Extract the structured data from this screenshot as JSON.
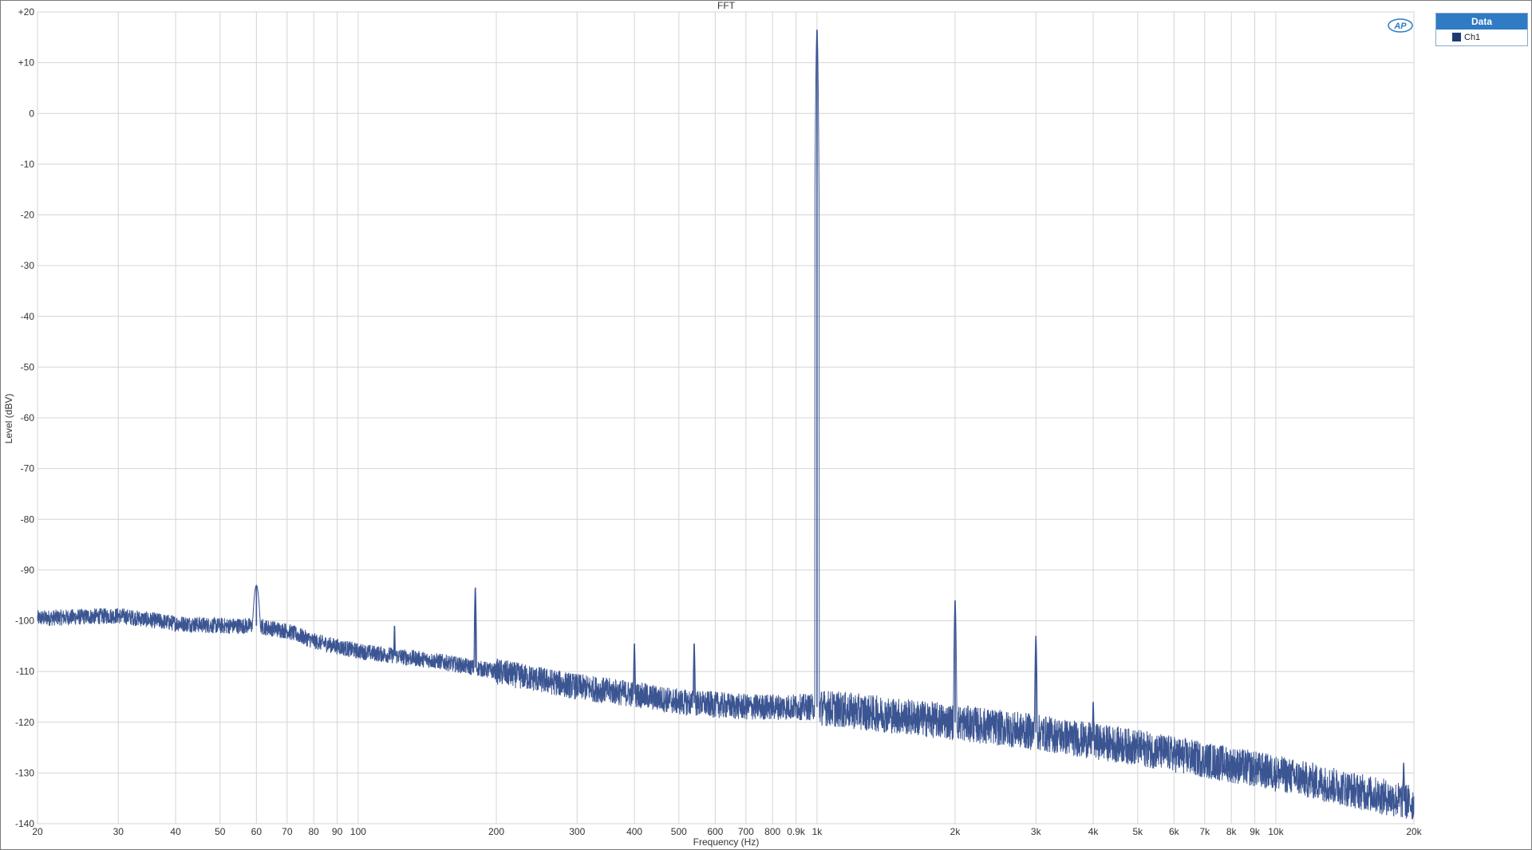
{
  "chart_data": {
    "type": "line",
    "title": "FFT",
    "xlabel": "Frequency (Hz)",
    "ylabel": "Level (dBV)",
    "x_scale": "log",
    "xlim": [
      20,
      20000
    ],
    "ylim": [
      -140,
      20
    ],
    "grid": true,
    "legend_position": "top-right",
    "x_ticks": [
      {
        "v": 20,
        "label": "20"
      },
      {
        "v": 30,
        "label": "30"
      },
      {
        "v": 40,
        "label": "40"
      },
      {
        "v": 50,
        "label": "50"
      },
      {
        "v": 60,
        "label": "60"
      },
      {
        "v": 70,
        "label": "70"
      },
      {
        "v": 80,
        "label": "80"
      },
      {
        "v": 90,
        "label": "90"
      },
      {
        "v": 100,
        "label": "100"
      },
      {
        "v": 200,
        "label": "200"
      },
      {
        "v": 300,
        "label": "300"
      },
      {
        "v": 400,
        "label": "400"
      },
      {
        "v": 500,
        "label": "500"
      },
      {
        "v": 600,
        "label": "600"
      },
      {
        "v": 700,
        "label": "700"
      },
      {
        "v": 800,
        "label": "800"
      },
      {
        "v": 900,
        "label": "0.9k"
      },
      {
        "v": 1000,
        "label": "1k"
      },
      {
        "v": 2000,
        "label": "2k"
      },
      {
        "v": 3000,
        "label": "3k"
      },
      {
        "v": 4000,
        "label": "4k"
      },
      {
        "v": 5000,
        "label": "5k"
      },
      {
        "v": 6000,
        "label": "6k"
      },
      {
        "v": 7000,
        "label": "7k"
      },
      {
        "v": 8000,
        "label": "8k"
      },
      {
        "v": 9000,
        "label": "9k"
      },
      {
        "v": 10000,
        "label": "10k"
      },
      {
        "v": 20000,
        "label": "20k"
      }
    ],
    "y_ticks": [
      {
        "v": 20,
        "label": "+20"
      },
      {
        "v": 10,
        "label": "+10"
      },
      {
        "v": 0,
        "label": "0"
      },
      {
        "v": -10,
        "label": "-10"
      },
      {
        "v": -20,
        "label": "-20"
      },
      {
        "v": -30,
        "label": "-30"
      },
      {
        "v": -40,
        "label": "-40"
      },
      {
        "v": -50,
        "label": "-50"
      },
      {
        "v": -60,
        "label": "-60"
      },
      {
        "v": -70,
        "label": "-70"
      },
      {
        "v": -80,
        "label": "-80"
      },
      {
        "v": -90,
        "label": "-90"
      },
      {
        "v": -100,
        "label": "-100"
      },
      {
        "v": -110,
        "label": "-110"
      },
      {
        "v": -120,
        "label": "-120"
      },
      {
        "v": -130,
        "label": "-130"
      },
      {
        "v": -140,
        "label": "-140"
      }
    ],
    "series": [
      {
        "name": "Ch1",
        "color": "#3b5592",
        "noise_floor": [
          [
            20,
            -99.5
          ],
          [
            30,
            -99
          ],
          [
            40,
            -100.5
          ],
          [
            50,
            -101
          ],
          [
            60,
            -101
          ],
          [
            70,
            -102
          ],
          [
            80,
            -104
          ],
          [
            100,
            -106
          ],
          [
            150,
            -108
          ],
          [
            200,
            -110
          ],
          [
            300,
            -113
          ],
          [
            400,
            -114.5
          ],
          [
            500,
            -116
          ],
          [
            700,
            -117
          ],
          [
            1000,
            -117
          ],
          [
            2000,
            -120
          ],
          [
            3000,
            -122
          ],
          [
            5000,
            -125
          ],
          [
            10000,
            -130
          ],
          [
            20000,
            -136
          ]
        ],
        "peaks": [
          {
            "x": 60,
            "y": -93
          },
          {
            "x": 120,
            "y": -101
          },
          {
            "x": 180,
            "y": -93.5
          },
          {
            "x": 400,
            "y": -104.5
          },
          {
            "x": 540,
            "y": -104.5
          },
          {
            "x": 1000,
            "y": 16.5
          },
          {
            "x": 2000,
            "y": -96
          },
          {
            "x": 3000,
            "y": -103
          },
          {
            "x": 4000,
            "y": -116
          },
          {
            "x": 19000,
            "y": -128
          }
        ]
      }
    ]
  },
  "legend": {
    "header": "Data",
    "items": [
      {
        "label": "Ch1",
        "color": "#1f3a73"
      }
    ]
  },
  "logo": {
    "text": "AP",
    "color": "#2f7bc4"
  }
}
